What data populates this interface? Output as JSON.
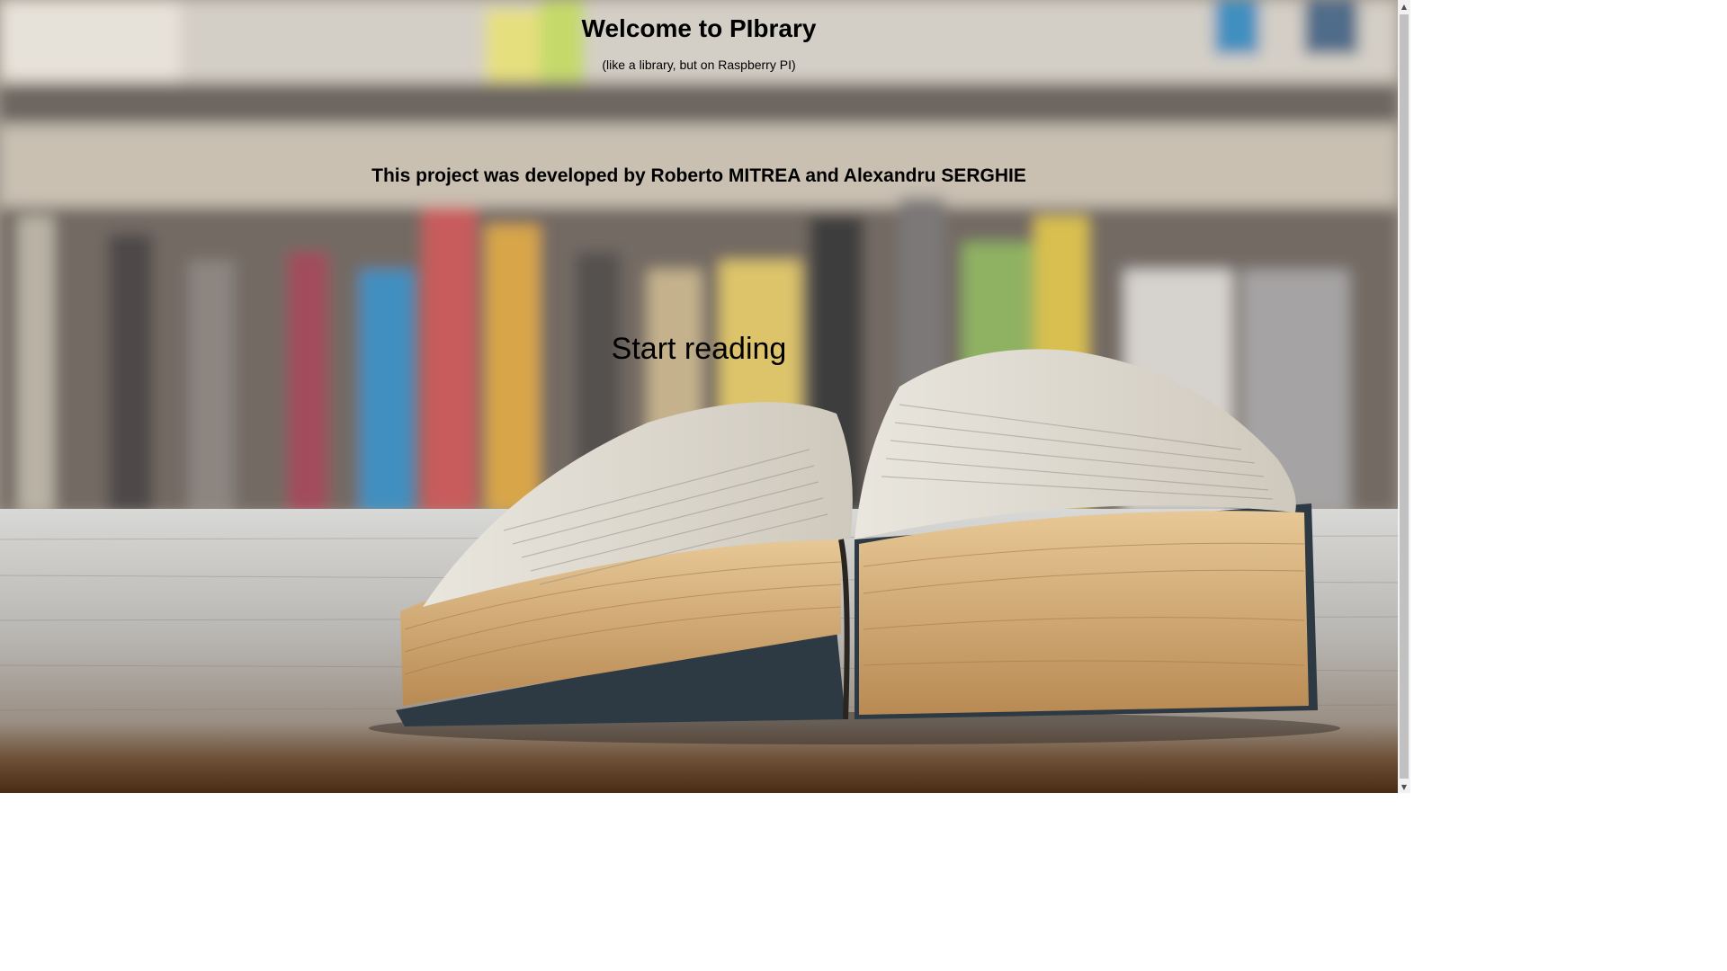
{
  "page": {
    "title": "Welcome to PIbrary",
    "subtitle": "(like a library, but on Raspberry PI)",
    "credits": "This project was developed by Roberto MITREA and Alexandru SERGHIE",
    "start_link": "Start reading"
  },
  "background": {
    "image": "open-book-icon",
    "description_colors": {
      "shelf": "#8c8377",
      "table": "#c8c8c6",
      "pages": "#d9b27c"
    }
  },
  "scrollbar": {
    "up_icon": "chevron-up-icon",
    "down_icon": "chevron-down-icon"
  }
}
